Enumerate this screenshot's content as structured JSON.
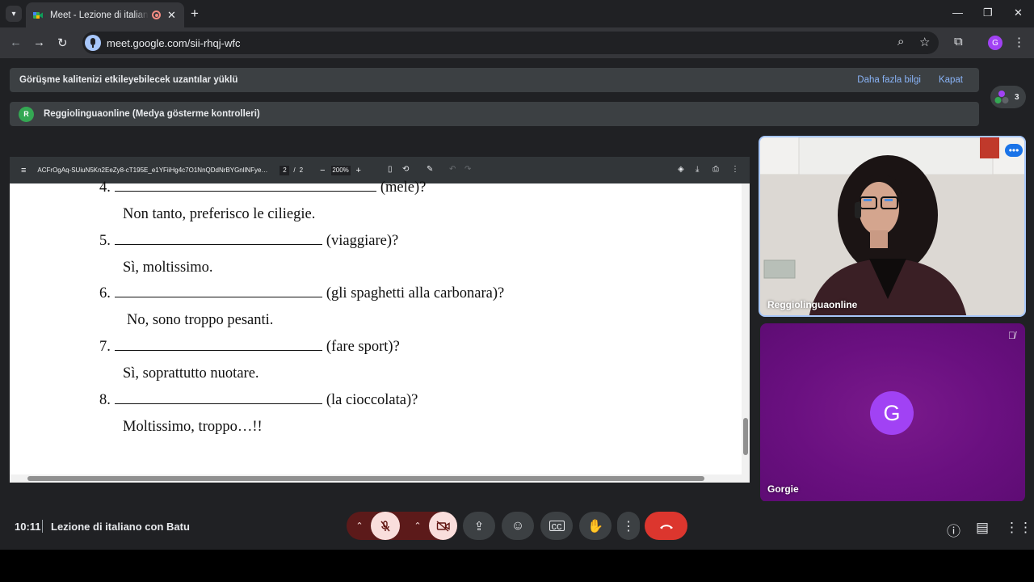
{
  "browser": {
    "tab": {
      "title": "Meet - Lezione di italiano con Batu",
      "favicon": "google-meet-icon",
      "recording_indicator": "recording-icon"
    },
    "url": "meet.google.com/sii-rhqj-wfc",
    "profile_initial": "G"
  },
  "banners": {
    "extensions": {
      "text": "Görüşme kalitenizi etkileyebilecek uzantılar yüklü",
      "more_info": "Daha fazla bilgi",
      "close": "Kapat"
    },
    "media_controls": {
      "badge": "R",
      "text": "Reggiolinguaonline (Medya gösterme kontrolleri)"
    },
    "participants_count": "3"
  },
  "pdf": {
    "filename": "ACFrOgAq-SUiuN5Kn2EeZy8-cT195E_e1YFiiHg4c7O1NnQDdNrBYGnllNFyez...",
    "page_current": "2",
    "page_separator": "/",
    "page_total": "2",
    "zoom": "200%",
    "exercises": [
      {
        "num": "4.",
        "hint": "(mele)?",
        "answer": "Non tanto, preferisco le ciliegie."
      },
      {
        "num": "5.",
        "hint": "(viaggiare)?",
        "answer": "Sì, moltissimo."
      },
      {
        "num": "6.",
        "hint": "(gli spaghetti alla carbonara)?",
        "answer": "No, sono troppo pesanti."
      },
      {
        "num": "7.",
        "hint": "(fare sport)?",
        "answer": "Sì, soprattutto nuotare."
      },
      {
        "num": "8.",
        "hint": "(la cioccolata)?",
        "answer": "Moltissimo, troppo…!!"
      }
    ]
  },
  "participants": {
    "teacher": {
      "name": "Reggiolinguaonline"
    },
    "student": {
      "name": "Gorgie",
      "initial": "G",
      "muted": true
    }
  },
  "meeting": {
    "time": "10:11",
    "name": "Lezione di italiano con Batu"
  },
  "colors": {
    "accent": "#a8c7fa",
    "end_call": "#dc362e",
    "muted_bg": "#f9dedc",
    "tile_purple": "#6a1080"
  }
}
